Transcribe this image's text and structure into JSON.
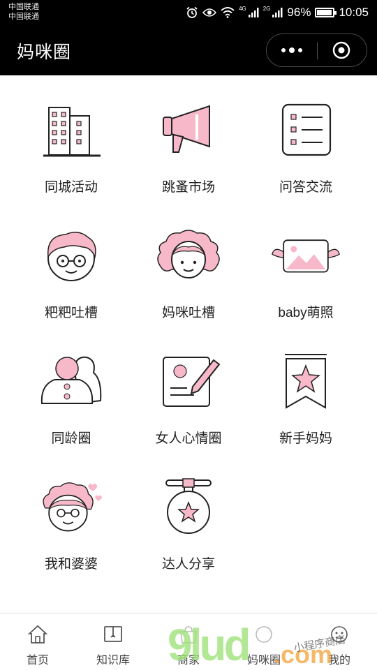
{
  "status_bar": {
    "carrier_1": "中国联通",
    "carrier_2": "中国联通",
    "signal_label_1": "4G",
    "signal_label_2": "2G",
    "battery": "96%",
    "battery_level": 0.96,
    "time": "10:05"
  },
  "nav": {
    "title": "妈咪圈",
    "more_icon": "more-dots-icon",
    "close_icon": "target-close-icon"
  },
  "accent_colors": {
    "pink": "#f7b9c9",
    "stroke": "#222222"
  },
  "grid": {
    "items": [
      {
        "label": "同城活动",
        "icon": "buildings-icon"
      },
      {
        "label": "跳蚤市场",
        "icon": "megaphone-icon"
      },
      {
        "label": "问答交流",
        "icon": "checklist-icon"
      },
      {
        "label": "粑粑吐槽",
        "icon": "dad-face-icon"
      },
      {
        "label": "妈咪吐槽",
        "icon": "mom-face-icon"
      },
      {
        "label": "baby萌照",
        "icon": "winged-photo-icon"
      },
      {
        "label": "同龄圈",
        "icon": "people-group-icon"
      },
      {
        "label": "女人心情圈",
        "icon": "note-pencil-icon"
      },
      {
        "label": "新手妈妈",
        "icon": "star-bookmark-icon"
      },
      {
        "label": "我和婆婆",
        "icon": "grandma-face-icon"
      },
      {
        "label": "达人分享",
        "icon": "star-medal-icon"
      }
    ]
  },
  "tabs": [
    {
      "label": "首页",
      "icon": "home-icon"
    },
    {
      "label": "知识库",
      "icon": "book-icon"
    },
    {
      "label": "商家",
      "icon": "store-icon"
    },
    {
      "label": "妈咪圈",
      "icon": "circle-icon"
    },
    {
      "label": "我的",
      "icon": "profile-icon"
    }
  ],
  "watermark": {
    "brand": "9lud",
    "suffix": ".com",
    "tagline": "小程序商店"
  }
}
